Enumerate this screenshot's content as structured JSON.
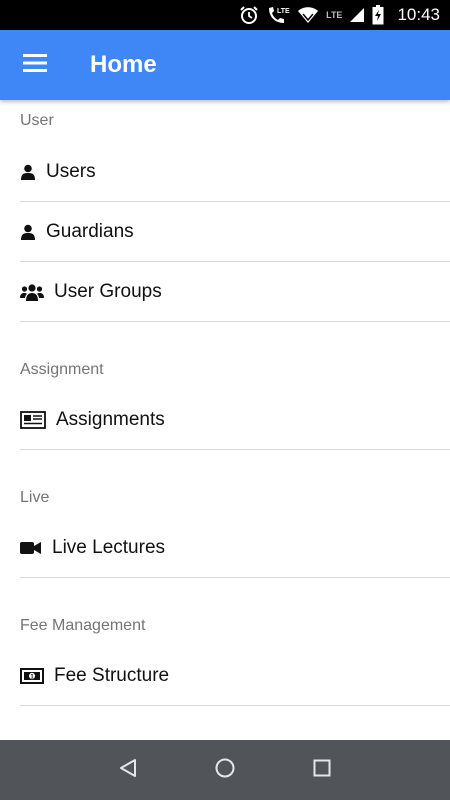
{
  "status_bar": {
    "time": "10:43",
    "network_label": "LTE",
    "icons": [
      "alarm-icon",
      "phone-lte-icon",
      "wifi-icon",
      "signal-icon",
      "battery-icon"
    ]
  },
  "app_bar": {
    "title": "Home",
    "menu_icon": "hamburger-menu-icon",
    "color": "#3f86f6"
  },
  "sections": {
    "user": {
      "header": "User",
      "items": [
        {
          "label": "Users",
          "icon": "user-icon"
        },
        {
          "label": "Guardians",
          "icon": "user-icon"
        },
        {
          "label": "User Groups",
          "icon": "users-icon"
        }
      ]
    },
    "assignment": {
      "header": "Assignment",
      "items": [
        {
          "label": "Assignments",
          "icon": "newspaper-icon"
        }
      ]
    },
    "live": {
      "header": "Live",
      "items": [
        {
          "label": "Live Lectures",
          "icon": "video-camera-icon"
        }
      ]
    },
    "fee": {
      "header": "Fee Management",
      "items": [
        {
          "label": "Fee Structure",
          "icon": "money-bill-icon"
        }
      ]
    }
  },
  "nav_bar": {
    "icons": [
      "back-icon",
      "home-icon",
      "recents-icon"
    ]
  }
}
